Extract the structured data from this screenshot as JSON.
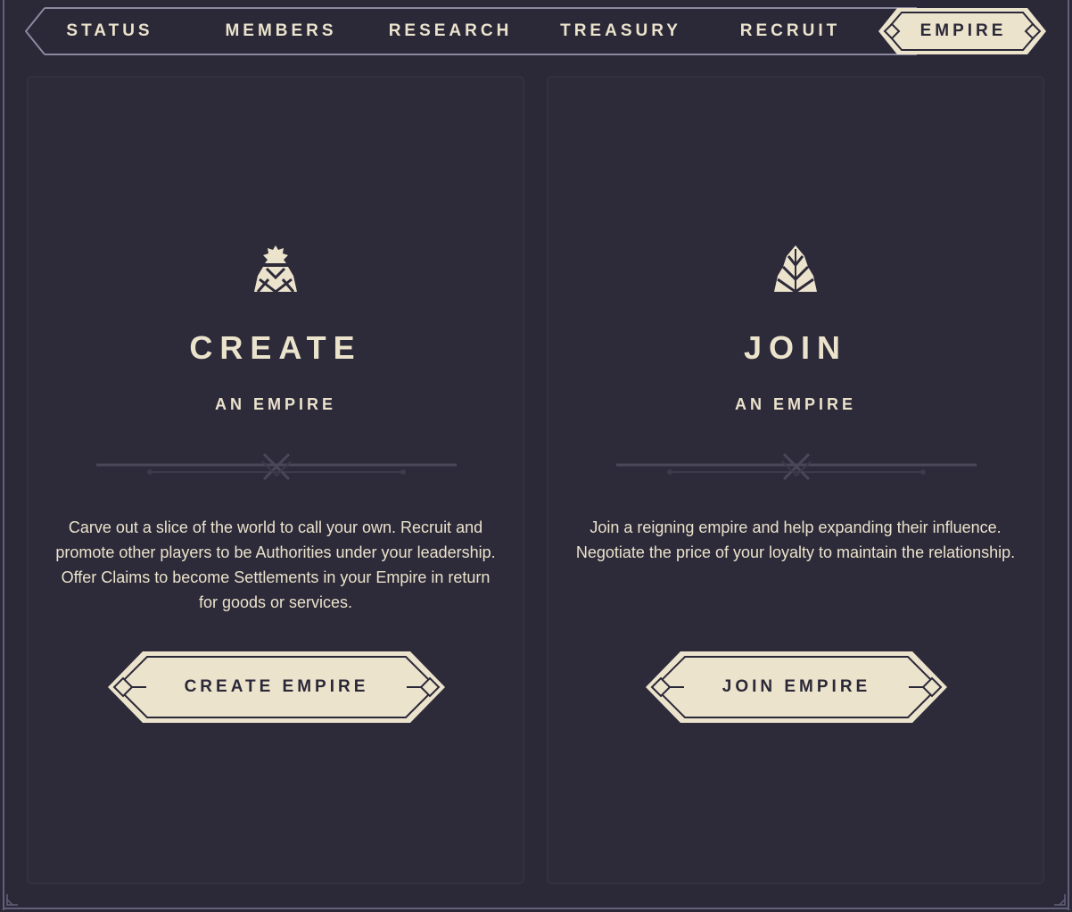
{
  "tabs": [
    {
      "id": "status",
      "label": "STATUS",
      "active": false
    },
    {
      "id": "members",
      "label": "MEMBERS",
      "active": false
    },
    {
      "id": "research",
      "label": "RESEARCH",
      "active": false
    },
    {
      "id": "treasury",
      "label": "TREASURY",
      "active": false
    },
    {
      "id": "recruit",
      "label": "RECRUIT",
      "active": false
    },
    {
      "id": "empire",
      "label": "EMPIRE",
      "active": true
    }
  ],
  "create_panel": {
    "icon": "crown-tower-icon",
    "title": "CREATE",
    "subtitle": "AN EMPIRE",
    "description": "Carve out a slice of the world to call your own. Recruit and promote other players to be Authorities under your leadership. Offer Claims to become Settlements in your Empire in return for goods or services.",
    "button_label": "CREATE EMPIRE"
  },
  "join_panel": {
    "icon": "tower-icon",
    "title": "JOIN",
    "subtitle": "AN EMPIRE",
    "description": "Join a reigning empire and help expanding their influence. Negotiate the price of your loyalty to maintain the relationship.",
    "button_label": "JOIN EMPIRE"
  },
  "colors": {
    "background": "#2b2838",
    "panel": "#2d2a39",
    "accent": "#ebe3cc",
    "frame": "#62607a"
  }
}
